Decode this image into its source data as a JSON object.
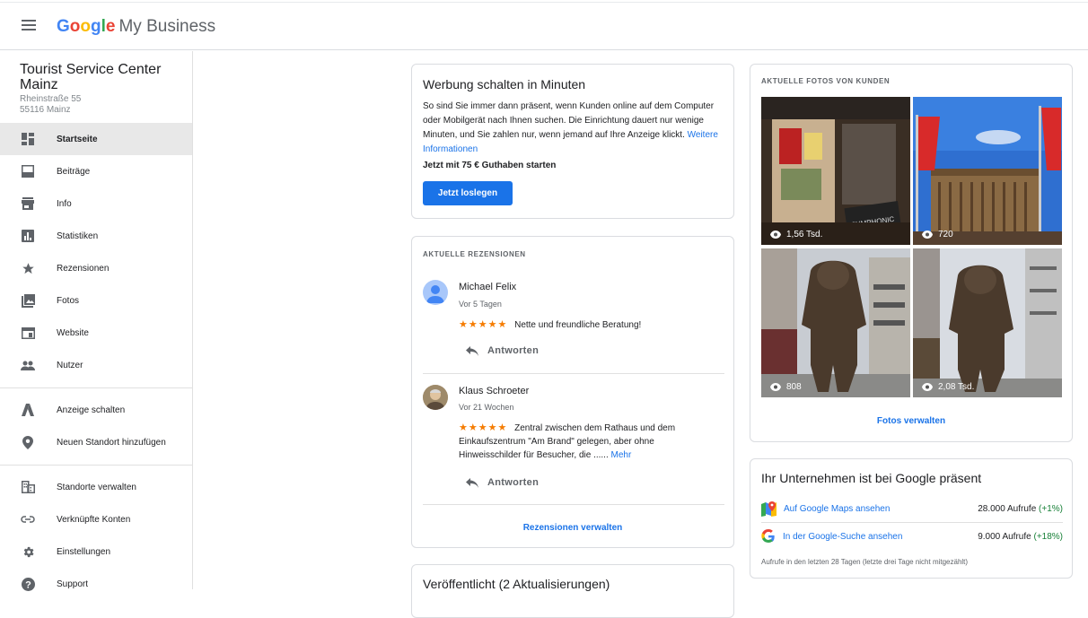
{
  "header": {
    "logo_google": [
      "G",
      "o",
      "o",
      "g",
      "l",
      "e"
    ],
    "product": "My Business"
  },
  "sidebar": {
    "business_name": "Tourist Service Center Mainz",
    "address_line1": "Rheinstraße 55",
    "address_line2": "55116 Mainz",
    "items": [
      {
        "label": "Startseite",
        "icon": "dashboard-icon"
      },
      {
        "label": "Beiträge",
        "icon": "posts-icon"
      },
      {
        "label": "Info",
        "icon": "store-icon"
      },
      {
        "label": "Statistiken",
        "icon": "insights-icon"
      },
      {
        "label": "Rezensionen",
        "icon": "star-icon"
      },
      {
        "label": "Fotos",
        "icon": "photos-icon"
      },
      {
        "label": "Website",
        "icon": "website-icon"
      },
      {
        "label": "Nutzer",
        "icon": "users-icon"
      },
      {
        "label": "Anzeige schalten",
        "icon": "ads-icon"
      },
      {
        "label": "Neuen Standort hinzufügen",
        "icon": "location-pin-icon"
      },
      {
        "label": "Standorte verwalten",
        "icon": "buildings-icon"
      },
      {
        "label": "Verknüpfte Konten",
        "icon": "link-icon"
      },
      {
        "label": "Einstellungen",
        "icon": "gear-icon"
      },
      {
        "label": "Support",
        "icon": "help-icon"
      }
    ]
  },
  "ads_card": {
    "title": "Werbung schalten in Minuten",
    "body": "So sind Sie immer dann präsent, wenn Kunden online auf dem Computer oder Mobilgerät nach Ihnen suchen. Die Einrichtung dauert nur wenige Minuten, und Sie zahlen nur, wenn jemand auf Ihre Anzeige klickt.",
    "more_link": "Weitere Informationen",
    "offer": "Jetzt mit 75 € Guthaben starten",
    "button": "Jetzt loslegen"
  },
  "reviews_card": {
    "overline": "AKTUELLE REZENSIONEN",
    "reviews": [
      {
        "name": "Michael Felix",
        "date": "Vor 5 Tagen",
        "stars": "★★★★★",
        "text": "Nette und freundliche Beratung!",
        "more": ""
      },
      {
        "name": "Klaus Schroeter",
        "date": "Vor 21 Wochen",
        "stars": "★★★★★",
        "text": "Zentral zwischen dem Rathaus und dem Einkaufszentrum \"Am Brand\" gelegen, aber ohne Hinweisschilder für Besucher, die ......",
        "more": "Mehr"
      }
    ],
    "reply_label": "Antworten",
    "manage": "Rezensionen verwalten"
  },
  "published_card": {
    "title": "Veröffentlicht (2 Aktualisierungen)"
  },
  "photos_card": {
    "overline": "AKTUELLE FOTOS VON KUNDEN",
    "photos": [
      {
        "views": "1,56 Tsd."
      },
      {
        "views": "720"
      },
      {
        "views": "808"
      },
      {
        "views": "2,08 Tsd."
      }
    ],
    "manage": "Fotos verwalten"
  },
  "presence_card": {
    "title": "Ihr Unternehmen ist bei Google präsent",
    "rows": [
      {
        "label": "Auf Google Maps ansehen",
        "count": "28.000 Aufrufe",
        "change": "(+1%)"
      },
      {
        "label": "In der Google-Suche ansehen",
        "count": "9.000 Aufrufe",
        "change": "(+18%)"
      }
    ],
    "footnote": "Aufrufe in den letzten 28 Tagen (letzte drei Tage nicht mitgezählt)"
  },
  "colors": {
    "accent": "#1a73e8",
    "star": "#f57c00",
    "positive": "#188038"
  }
}
